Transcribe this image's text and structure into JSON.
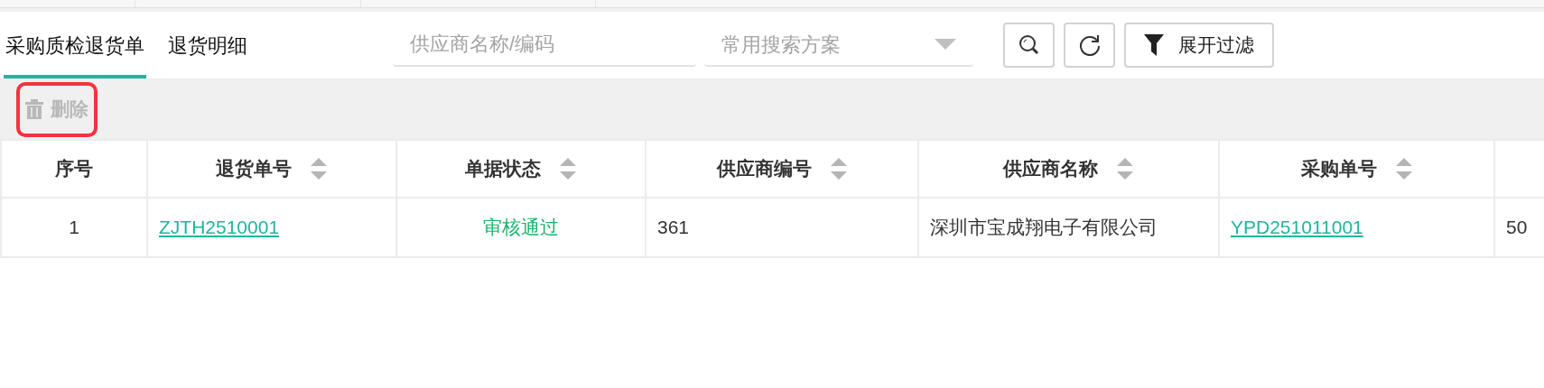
{
  "tabs": [
    {
      "label": "采购质检退货单",
      "selected": true
    },
    {
      "label": "退货明细",
      "selected": false
    }
  ],
  "search": {
    "placeholder": "供应商名称/编码"
  },
  "scheme_select": {
    "placeholder": "常用搜索方案"
  },
  "filter_button": {
    "label": "展开过滤"
  },
  "toolbar": {
    "delete_button": {
      "label": "删除",
      "disabled": true,
      "highlighted": true
    }
  },
  "table": {
    "columns": [
      {
        "label": "序号",
        "sortable": false
      },
      {
        "label": "退货单号",
        "sortable": true
      },
      {
        "label": "单据状态",
        "sortable": true
      },
      {
        "label": "供应商编号",
        "sortable": true
      },
      {
        "label": "供应商名称",
        "sortable": true
      },
      {
        "label": "采购单号",
        "sortable": true
      }
    ],
    "rows": [
      {
        "cells": [
          {
            "kind": "index",
            "text": "1"
          },
          {
            "kind": "link",
            "text": "ZJTH2510001"
          },
          {
            "kind": "status",
            "text": "审核通过"
          },
          {
            "kind": "text",
            "text": "361"
          },
          {
            "kind": "text",
            "text": "深圳市宝成翔电子有限公司"
          },
          {
            "kind": "link",
            "text": "YPD251011001"
          },
          {
            "kind": "text",
            "text": "50"
          }
        ]
      }
    ]
  }
}
